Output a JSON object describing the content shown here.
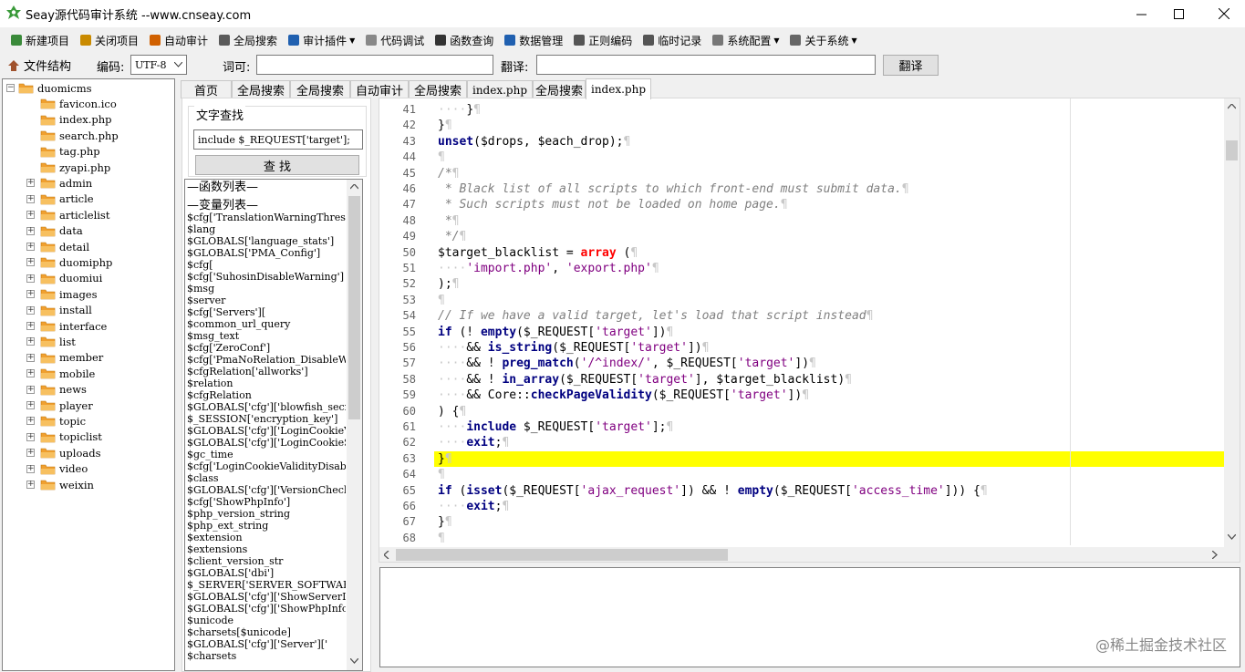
{
  "window": {
    "title": "Seay源代码审计系统  --www.cnseay.com"
  },
  "toolbar": {
    "items": [
      {
        "label": "新建项目",
        "icon": "new-project-icon"
      },
      {
        "label": "关闭项目",
        "icon": "close-project-icon"
      },
      {
        "label": "自动审计",
        "icon": "auto-audit-icon"
      },
      {
        "label": "全局搜索",
        "icon": "global-search-icon"
      },
      {
        "label": "审计插件",
        "icon": "audit-plugin-icon",
        "dropdown": true
      },
      {
        "label": "代码调试",
        "icon": "code-debug-icon"
      },
      {
        "label": "函数查询",
        "icon": "function-search-icon"
      },
      {
        "label": "数据管理",
        "icon": "data-manage-icon"
      },
      {
        "label": "正则编码",
        "icon": "regex-encode-icon"
      },
      {
        "label": "临时记录",
        "icon": "temp-notes-icon"
      },
      {
        "label": "系统配置",
        "icon": "gear-icon",
        "dropdown": true
      },
      {
        "label": "关于系统",
        "icon": "about-icon",
        "dropdown": true
      }
    ]
  },
  "bar2": {
    "file_structure_label": "文件结构",
    "encoding_label": "编码:",
    "encoding_value": "UTF-8",
    "word_label": "词可:",
    "word_value": "",
    "translate_label": "翻译:",
    "translate_value": "",
    "translate_button": "翻译"
  },
  "tree": {
    "root": "duomicms",
    "files": [
      "favicon.ico",
      "index.php",
      "search.php",
      "tag.php",
      "zyapi.php"
    ],
    "folders": [
      "admin",
      "article",
      "articlelist",
      "data",
      "detail",
      "duomiphp",
      "duomiui",
      "images",
      "install",
      "interface",
      "list",
      "member",
      "mobile",
      "news",
      "player",
      "topic",
      "topiclist",
      "uploads",
      "video",
      "weixin"
    ]
  },
  "tabs": [
    {
      "label": "首页",
      "mono": false
    },
    {
      "label": "全局搜索",
      "mono": false
    },
    {
      "label": "全局搜索",
      "mono": false
    },
    {
      "label": "自动审计",
      "mono": false
    },
    {
      "label": "全局搜索",
      "mono": false
    },
    {
      "label": "index.php",
      "mono": true
    },
    {
      "label": "全局搜索",
      "mono": false
    },
    {
      "label": "index.php",
      "mono": true,
      "active": true
    }
  ],
  "search_panel": {
    "group_title": "文字查找",
    "query": "include $_REQUEST['target'];",
    "button": "查 找"
  },
  "func_list": {
    "func_header": "—函数列表—",
    "var_header": "—变量列表—",
    "items": [
      "$cfg['TranslationWarningThreshold']",
      "$lang",
      "$GLOBALS['language_stats']",
      "$GLOBALS['PMA_Config']",
      "$cfg[",
      "$cfg['SuhosinDisableWarning']",
      "$msg",
      "$server",
      "$cfg['Servers'][",
      "$common_url_query",
      "$msg_text",
      "$cfg['ZeroConf']",
      "$cfg['PmaNoRelation_DisableWarning']",
      "$cfgRelation['allworks']",
      "$relation",
      "$cfgRelation",
      "$GLOBALS['cfg']['blowfish_secret']",
      "$_SESSION['encryption_key']",
      "$GLOBALS['cfg']['LoginCookieValidity']",
      "$GLOBALS['cfg']['LoginCookieStore']",
      "$gc_time",
      "$cfg['LoginCookieValidityDisableWarning']",
      "$class",
      "$GLOBALS['cfg']['VersionCheck']",
      "$cfg['ShowPhpInfo']",
      "$php_version_string",
      "$php_ext_string",
      "$extension",
      "$extensions",
      "$client_version_str",
      "$GLOBALS['dbi']",
      "$_SERVER['SERVER_SOFTWARE']",
      "$GLOBALS['cfg']['ShowServerInfo']",
      "$GLOBALS['cfg']['ShowPhpInfo']",
      "$unicode",
      "$charsets[$unicode]",
      "$GLOBALS['cfg']['Server']['",
      "$charsets"
    ]
  },
  "editor": {
    "highlight_line": 63,
    "lines": [
      {
        "n": "41",
        "html": "<span class='dot'>····</span>}<span class='pil'>¶</span>"
      },
      {
        "n": "42",
        "html": "}<span class='pil'>¶</span>"
      },
      {
        "n": "43",
        "html": "<span class='fn'>unset</span>($drops, $each_drop);<span class='pil'>¶</span>"
      },
      {
        "n": "44",
        "html": "<span class='pil'>¶</span>"
      },
      {
        "n": "45",
        "html": "<span class='cmt'>/*</span><span class='pil'>¶</span>"
      },
      {
        "n": "46",
        "html": "<span class='cmt'> * Black list of all scripts to which front-end must submit data.</span><span class='pil'>¶</span>"
      },
      {
        "n": "47",
        "html": "<span class='cmt'> * Such scripts must not be loaded on home page.</span><span class='pil'>¶</span>"
      },
      {
        "n": "48",
        "html": "<span class='cmt'> *</span><span class='pil'>¶</span>"
      },
      {
        "n": "49",
        "html": "<span class='cmt'> */</span><span class='pil'>¶</span>"
      },
      {
        "n": "50",
        "html": "$target_blacklist = <span class='kw-red'>array</span> (<span class='pil'>¶</span>"
      },
      {
        "n": "51",
        "html": "<span class='dot'>····</span><span class='str'>'import.php'</span>, <span class='str'>'export.php'</span><span class='pil'>¶</span>"
      },
      {
        "n": "52",
        "html": ");<span class='pil'>¶</span>"
      },
      {
        "n": "53",
        "html": "<span class='pil'>¶</span>"
      },
      {
        "n": "54",
        "html": "<span class='cmt'>// If we have a valid target, let's load that script instead</span><span class='pil'>¶</span>"
      },
      {
        "n": "55",
        "html": "<span class='kw'>if</span> (! <span class='fn'>empty</span>($_REQUEST[<span class='str'>'target'</span>])<span class='pil'>¶</span>"
      },
      {
        "n": "56",
        "html": "<span class='dot'>····</span>&amp;&amp; <span class='fn'>is_string</span>($_REQUEST[<span class='str'>'target'</span>])<span class='pil'>¶</span>"
      },
      {
        "n": "57",
        "html": "<span class='dot'>····</span>&amp;&amp; ! <span class='fn'>preg_match</span>(<span class='str'>'/^index/'</span>, $_REQUEST[<span class='str'>'target'</span>])<span class='pil'>¶</span>"
      },
      {
        "n": "58",
        "html": "<span class='dot'>····</span>&amp;&amp; ! <span class='fn'>in_array</span>($_REQUEST[<span class='str'>'target'</span>], $target_blacklist)<span class='pil'>¶</span>"
      },
      {
        "n": "59",
        "html": "<span class='dot'>····</span>&amp;&amp; Core::<span class='fn'>checkPageValidity</span>($_REQUEST[<span class='str'>'target'</span>])<span class='pil'>¶</span>"
      },
      {
        "n": "60",
        "html": ") {<span class='pil'>¶</span>"
      },
      {
        "n": "61",
        "html": "<span class='dot'>····</span><span class='kw'>include</span> $_REQUEST[<span class='str'>'target'</span>];<span class='pil'>¶</span>"
      },
      {
        "n": "62",
        "html": "<span class='dot'>····</span><span class='kw'>exit</span>;<span class='pil'>¶</span>"
      },
      {
        "n": "63",
        "html": "}<span class='pil'>¶</span>"
      },
      {
        "n": "64",
        "html": "<span class='pil'>¶</span>"
      },
      {
        "n": "65",
        "html": "<span class='kw'>if</span> (<span class='fn'>isset</span>($_REQUEST[<span class='str'>'ajax_request'</span>]) &amp;&amp; ! <span class='fn'>empty</span>($_REQUEST[<span class='str'>'access_time'</span>])) {<span class='pil'>¶</span>"
      },
      {
        "n": "66",
        "html": "<span class='dot'>····</span><span class='kw'>exit</span>;<span class='pil'>¶</span>"
      },
      {
        "n": "67",
        "html": "}<span class='pil'>¶</span>"
      },
      {
        "n": "68",
        "html": "<span class='pil'>¶</span>"
      }
    ]
  },
  "watermark": "@稀土掘金技术社区"
}
